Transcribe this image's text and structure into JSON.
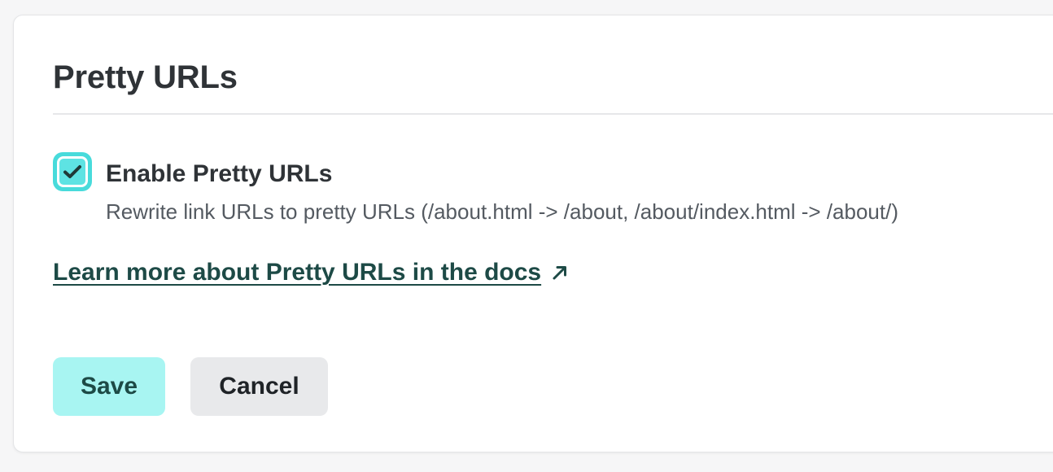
{
  "section": {
    "title": "Pretty URLs"
  },
  "option": {
    "checked": true,
    "label": "Enable Pretty URLs",
    "description": "Rewrite link URLs to pretty URLs (/about.html -> /about, /about/index.html -> /about/)"
  },
  "docs_link": {
    "text": "Learn more about Pretty URLs in the docs",
    "icon": "arrow-up-right-icon"
  },
  "actions": {
    "save_label": "Save",
    "cancel_label": "Cancel"
  },
  "colors": {
    "accent": "#48dbdb",
    "save_bg": "#a8f5f2",
    "link": "#1d4a46",
    "cancel_bg": "#e8e9eb"
  }
}
